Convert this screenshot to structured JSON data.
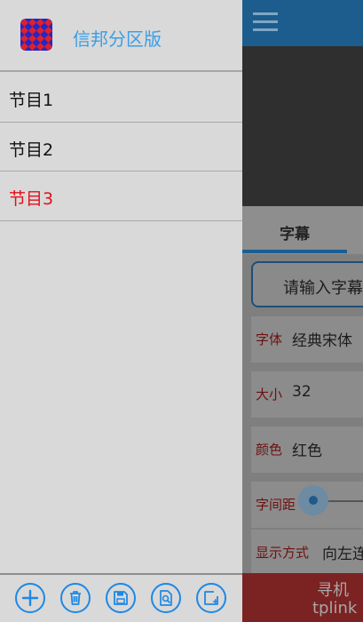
{
  "drawer": {
    "app_title": "信邦分区版",
    "programs": [
      {
        "label": "节目1",
        "active": false
      },
      {
        "label": "节目2",
        "active": false
      },
      {
        "label": "节目3",
        "active": true
      }
    ],
    "toolbar": [
      {
        "icon": "add-icon",
        "action": "add"
      },
      {
        "icon": "trash-icon",
        "action": "delete"
      },
      {
        "icon": "save-icon",
        "action": "save"
      },
      {
        "icon": "preview-search-icon",
        "action": "preview"
      },
      {
        "icon": "edit-box-icon",
        "action": "edit"
      }
    ]
  },
  "background": {
    "tab_label": "字幕",
    "subtitle_input_text": "请输入字幕",
    "settings": [
      {
        "key": "字体",
        "value": "经典宋体"
      },
      {
        "key": "大小",
        "value": "32"
      },
      {
        "key": "颜色",
        "value": "红色"
      },
      {
        "key": "字间距",
        "value": ""
      },
      {
        "key": "显示方式",
        "value": "向左连"
      }
    ],
    "bottom_text_1": "寻机",
    "bottom_text_2": "tplink"
  },
  "colors": {
    "accent": "#1e88e5",
    "active_item": "#e3101a",
    "title": "#3a9ee6"
  }
}
